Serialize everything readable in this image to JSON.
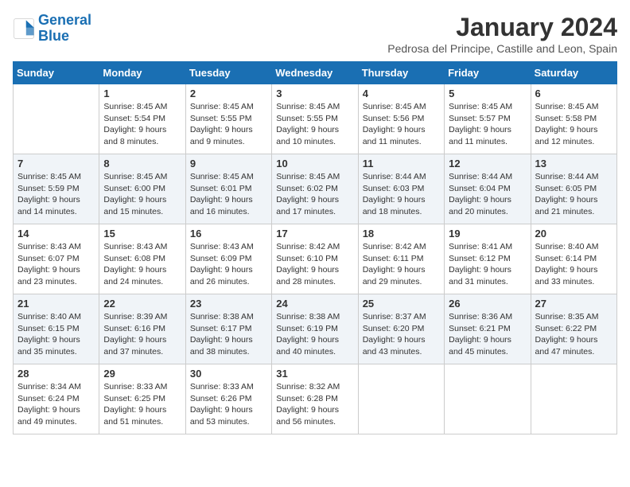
{
  "logo": {
    "line1": "General",
    "line2": "Blue"
  },
  "title": "January 2024",
  "subtitle": "Pedrosa del Principe, Castille and Leon, Spain",
  "days_header": [
    "Sunday",
    "Monday",
    "Tuesday",
    "Wednesday",
    "Thursday",
    "Friday",
    "Saturday"
  ],
  "weeks": [
    [
      {
        "day": "",
        "lines": []
      },
      {
        "day": "1",
        "lines": [
          "Sunrise: 8:45 AM",
          "Sunset: 5:54 PM",
          "Daylight: 9 hours",
          "and 8 minutes."
        ]
      },
      {
        "day": "2",
        "lines": [
          "Sunrise: 8:45 AM",
          "Sunset: 5:55 PM",
          "Daylight: 9 hours",
          "and 9 minutes."
        ]
      },
      {
        "day": "3",
        "lines": [
          "Sunrise: 8:45 AM",
          "Sunset: 5:55 PM",
          "Daylight: 9 hours",
          "and 10 minutes."
        ]
      },
      {
        "day": "4",
        "lines": [
          "Sunrise: 8:45 AM",
          "Sunset: 5:56 PM",
          "Daylight: 9 hours",
          "and 11 minutes."
        ]
      },
      {
        "day": "5",
        "lines": [
          "Sunrise: 8:45 AM",
          "Sunset: 5:57 PM",
          "Daylight: 9 hours",
          "and 11 minutes."
        ]
      },
      {
        "day": "6",
        "lines": [
          "Sunrise: 8:45 AM",
          "Sunset: 5:58 PM",
          "Daylight: 9 hours",
          "and 12 minutes."
        ]
      }
    ],
    [
      {
        "day": "7",
        "lines": [
          "Sunrise: 8:45 AM",
          "Sunset: 5:59 PM",
          "Daylight: 9 hours",
          "and 14 minutes."
        ]
      },
      {
        "day": "8",
        "lines": [
          "Sunrise: 8:45 AM",
          "Sunset: 6:00 PM",
          "Daylight: 9 hours",
          "and 15 minutes."
        ]
      },
      {
        "day": "9",
        "lines": [
          "Sunrise: 8:45 AM",
          "Sunset: 6:01 PM",
          "Daylight: 9 hours",
          "and 16 minutes."
        ]
      },
      {
        "day": "10",
        "lines": [
          "Sunrise: 8:45 AM",
          "Sunset: 6:02 PM",
          "Daylight: 9 hours",
          "and 17 minutes."
        ]
      },
      {
        "day": "11",
        "lines": [
          "Sunrise: 8:44 AM",
          "Sunset: 6:03 PM",
          "Daylight: 9 hours",
          "and 18 minutes."
        ]
      },
      {
        "day": "12",
        "lines": [
          "Sunrise: 8:44 AM",
          "Sunset: 6:04 PM",
          "Daylight: 9 hours",
          "and 20 minutes."
        ]
      },
      {
        "day": "13",
        "lines": [
          "Sunrise: 8:44 AM",
          "Sunset: 6:05 PM",
          "Daylight: 9 hours",
          "and 21 minutes."
        ]
      }
    ],
    [
      {
        "day": "14",
        "lines": [
          "Sunrise: 8:43 AM",
          "Sunset: 6:07 PM",
          "Daylight: 9 hours",
          "and 23 minutes."
        ]
      },
      {
        "day": "15",
        "lines": [
          "Sunrise: 8:43 AM",
          "Sunset: 6:08 PM",
          "Daylight: 9 hours",
          "and 24 minutes."
        ]
      },
      {
        "day": "16",
        "lines": [
          "Sunrise: 8:43 AM",
          "Sunset: 6:09 PM",
          "Daylight: 9 hours",
          "and 26 minutes."
        ]
      },
      {
        "day": "17",
        "lines": [
          "Sunrise: 8:42 AM",
          "Sunset: 6:10 PM",
          "Daylight: 9 hours",
          "and 28 minutes."
        ]
      },
      {
        "day": "18",
        "lines": [
          "Sunrise: 8:42 AM",
          "Sunset: 6:11 PM",
          "Daylight: 9 hours",
          "and 29 minutes."
        ]
      },
      {
        "day": "19",
        "lines": [
          "Sunrise: 8:41 AM",
          "Sunset: 6:12 PM",
          "Daylight: 9 hours",
          "and 31 minutes."
        ]
      },
      {
        "day": "20",
        "lines": [
          "Sunrise: 8:40 AM",
          "Sunset: 6:14 PM",
          "Daylight: 9 hours",
          "and 33 minutes."
        ]
      }
    ],
    [
      {
        "day": "21",
        "lines": [
          "Sunrise: 8:40 AM",
          "Sunset: 6:15 PM",
          "Daylight: 9 hours",
          "and 35 minutes."
        ]
      },
      {
        "day": "22",
        "lines": [
          "Sunrise: 8:39 AM",
          "Sunset: 6:16 PM",
          "Daylight: 9 hours",
          "and 37 minutes."
        ]
      },
      {
        "day": "23",
        "lines": [
          "Sunrise: 8:38 AM",
          "Sunset: 6:17 PM",
          "Daylight: 9 hours",
          "and 38 minutes."
        ]
      },
      {
        "day": "24",
        "lines": [
          "Sunrise: 8:38 AM",
          "Sunset: 6:19 PM",
          "Daylight: 9 hours",
          "and 40 minutes."
        ]
      },
      {
        "day": "25",
        "lines": [
          "Sunrise: 8:37 AM",
          "Sunset: 6:20 PM",
          "Daylight: 9 hours",
          "and 43 minutes."
        ]
      },
      {
        "day": "26",
        "lines": [
          "Sunrise: 8:36 AM",
          "Sunset: 6:21 PM",
          "Daylight: 9 hours",
          "and 45 minutes."
        ]
      },
      {
        "day": "27",
        "lines": [
          "Sunrise: 8:35 AM",
          "Sunset: 6:22 PM",
          "Daylight: 9 hours",
          "and 47 minutes."
        ]
      }
    ],
    [
      {
        "day": "28",
        "lines": [
          "Sunrise: 8:34 AM",
          "Sunset: 6:24 PM",
          "Daylight: 9 hours",
          "and 49 minutes."
        ]
      },
      {
        "day": "29",
        "lines": [
          "Sunrise: 8:33 AM",
          "Sunset: 6:25 PM",
          "Daylight: 9 hours",
          "and 51 minutes."
        ]
      },
      {
        "day": "30",
        "lines": [
          "Sunrise: 8:33 AM",
          "Sunset: 6:26 PM",
          "Daylight: 9 hours",
          "and 53 minutes."
        ]
      },
      {
        "day": "31",
        "lines": [
          "Sunrise: 8:32 AM",
          "Sunset: 6:28 PM",
          "Daylight: 9 hours",
          "and 56 minutes."
        ]
      },
      {
        "day": "",
        "lines": []
      },
      {
        "day": "",
        "lines": []
      },
      {
        "day": "",
        "lines": []
      }
    ]
  ]
}
